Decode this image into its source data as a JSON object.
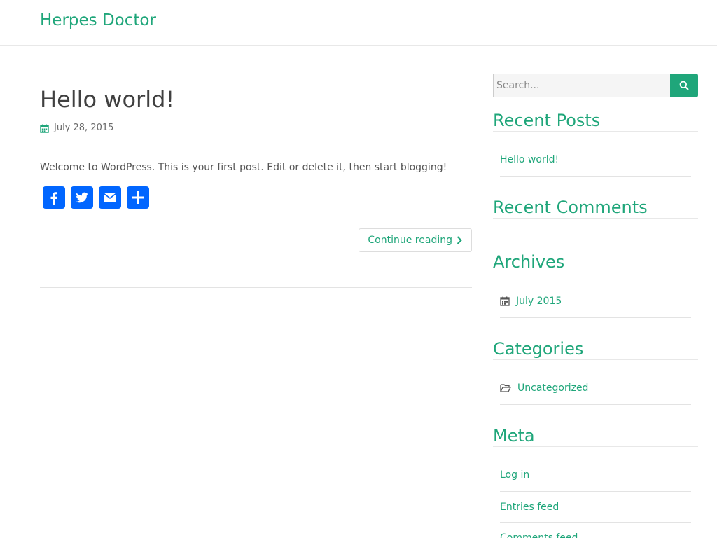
{
  "site": {
    "title": "Herpes Doctor"
  },
  "post": {
    "title": "Hello world!",
    "date": "July 28, 2015",
    "excerpt": "Welcome to WordPress. This is your first post. Edit or delete it, then start blogging!",
    "share_buttons": [
      "facebook-icon",
      "twitter-icon",
      "email-icon",
      "share-icon"
    ],
    "continue_label": "Continue reading"
  },
  "sidebar": {
    "search_placeholder": "Search...",
    "recent_posts": {
      "title": "Recent Posts",
      "items": [
        "Hello world!"
      ]
    },
    "recent_comments": {
      "title": "Recent Comments",
      "items": []
    },
    "archives": {
      "title": "Archives",
      "items": [
        "July 2015"
      ]
    },
    "categories": {
      "title": "Categories",
      "items": [
        "Uncategorized"
      ]
    },
    "meta": {
      "title": "Meta",
      "items": [
        "Log in",
        "Entries feed",
        "Comments feed"
      ]
    }
  },
  "colors": {
    "accent": "#1fa67a",
    "share": "#0166ff",
    "text": "#555555",
    "heading": "#404040"
  }
}
